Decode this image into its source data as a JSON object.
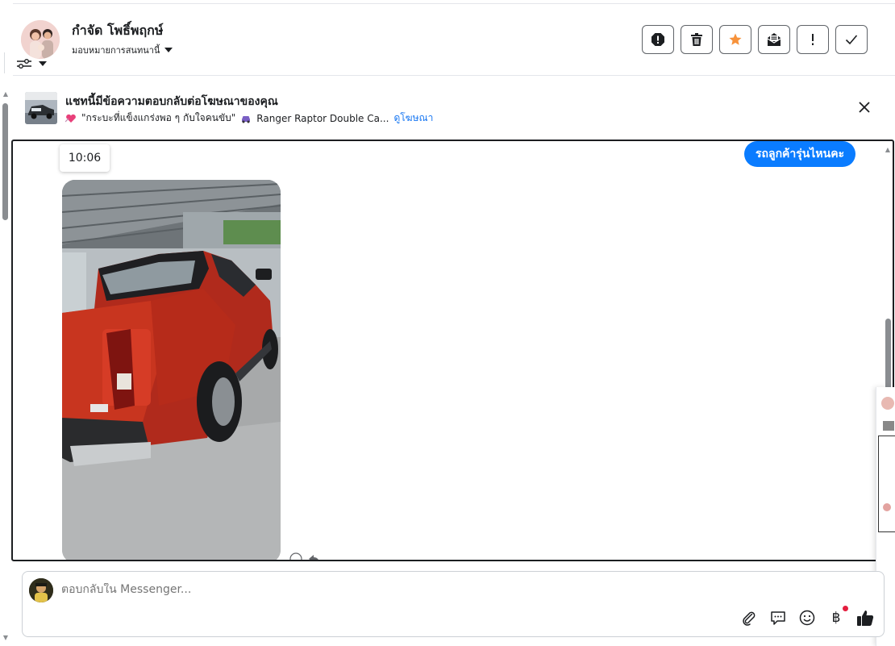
{
  "header": {
    "contact_name": "กำจัด โพธิ์พฤกษ์",
    "assign_label": "มอบหมายการสนทนานี้",
    "actions": [
      {
        "name": "spam-button",
        "icon": "alert-octagon-icon"
      },
      {
        "name": "delete-button",
        "icon": "trash-icon"
      },
      {
        "name": "follow-up-button",
        "icon": "star-icon"
      },
      {
        "name": "mark-unread-button",
        "icon": "envelope-open-icon"
      },
      {
        "name": "priority-button",
        "icon": "exclamation-icon"
      },
      {
        "name": "done-button",
        "icon": "checkmark-icon"
      }
    ],
    "star_color": "#f7923b"
  },
  "ad_bar": {
    "title": "แชทนี้มีข้อความตอบกลับต่อโฆษณาของคุณ",
    "ad_caption": "\"กระบะที่แข็งแกร่งพอ ๆ กับใจคนขับ\"",
    "ad_vehicle": "Ranger Raptor Double Ca...",
    "view_ad_link": "ดูโฆษณา"
  },
  "chat": {
    "timestamp": "10:06",
    "outgoing_message": "รถลูกค้ารุ่นไหนคะ",
    "bubble_color": "#0a7cff"
  },
  "composer": {
    "placeholder": "ตอบกลับใน Messenger...",
    "tools": [
      "paperclip-icon",
      "saved-replies-icon",
      "emoji-icon",
      "baht-payment-icon",
      "thumbs-up-icon"
    ]
  }
}
